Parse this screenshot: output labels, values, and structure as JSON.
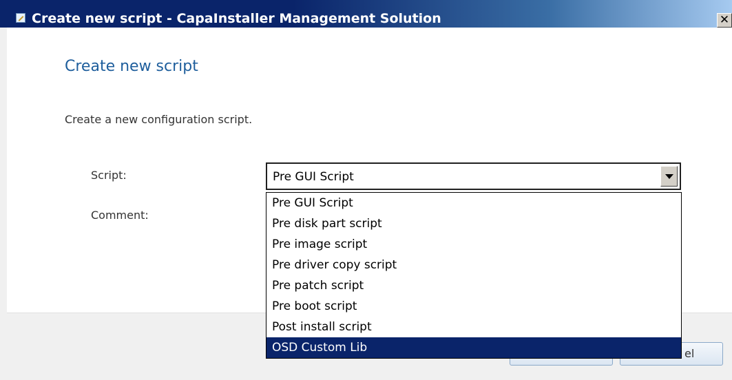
{
  "window": {
    "title": "Create new script - CapaInstaller Management Solution",
    "close_glyph": "✕"
  },
  "header": {
    "title": "Create new script",
    "description": "Create a new configuration script."
  },
  "form": {
    "script_label": "Script:",
    "comment_label": "Comment:",
    "script_value": "Pre GUI Script"
  },
  "dropdown": {
    "options": [
      "Pre GUI Script",
      "Pre disk part script",
      "Pre image script",
      "Pre driver copy script",
      "Pre patch script",
      "Pre boot script",
      "Post install script",
      "OSD Custom Lib"
    ],
    "highlighted": "OSD Custom Lib"
  },
  "buttons": {
    "cancel_visible_text": "el"
  },
  "colors": {
    "titlebar": "#0a246a",
    "heading": "#1e5e9c",
    "selection": "#0a246a"
  },
  "icons": [
    "app-icon",
    "close-icon",
    "dropdown-arrow-icon"
  ]
}
